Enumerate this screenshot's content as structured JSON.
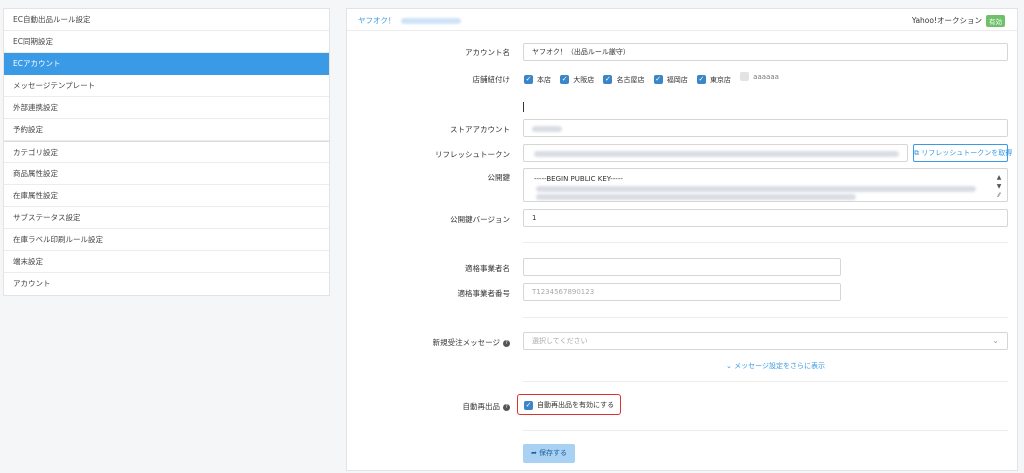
{
  "sidebar": {
    "items": [
      {
        "label": "EC自動出品ルール設定"
      },
      {
        "label": "EC同期設定"
      },
      {
        "label": "ECアカウント"
      },
      {
        "label": "メッセージテンプレート"
      },
      {
        "label": "外部連携設定"
      },
      {
        "label": "予約設定"
      },
      {
        "label": "カテゴリ設定"
      },
      {
        "label": "商品属性設定"
      },
      {
        "label": "在庫属性設定"
      },
      {
        "label": "サブステータス設定"
      },
      {
        "label": "在庫ラベル印刷ルール設定"
      },
      {
        "label": "端末設定"
      },
      {
        "label": "アカウント"
      }
    ]
  },
  "header": {
    "title": "ヤフオク！",
    "service": "Yahoo!オークション",
    "status_badge": "有効"
  },
  "form": {
    "account_name_label": "アカウント名",
    "account_name_value": "ヤフオク！（出品ルール厳守）",
    "stores_label": "店舗紐付け",
    "stores": [
      {
        "label": "本店",
        "checked": true
      },
      {
        "label": "大阪店",
        "checked": true
      },
      {
        "label": "名古屋店",
        "checked": true
      },
      {
        "label": "福岡店",
        "checked": true
      },
      {
        "label": "東京店",
        "checked": true
      },
      {
        "label": "aaaaaa",
        "checked": false
      }
    ],
    "store_account_label": "ストアアカウント",
    "refresh_token_label": "リフレッシュトークン",
    "refresh_button": "リフレッシュトークンを取得",
    "public_key_label": "公開鍵",
    "public_key_value": "-----BEGIN PUBLIC KEY-----",
    "public_key_version_label": "公開鍵バージョン",
    "public_key_version_value": "1",
    "business_name_label": "適格事業者名",
    "business_name_value": "",
    "business_number_label": "適格事業者番号",
    "business_number_placeholder": "T1234567890123",
    "new_order_message_label": "新規受注メッセージ",
    "new_order_message_placeholder": "選択してください",
    "more_messages_link": "⌄ メッセージ設定をさらに表示",
    "auto_relist_label": "自動再出品",
    "auto_relist_checkbox": "自動再出品を有効にする",
    "save_button": "保存する"
  },
  "colors": {
    "accent": "#3a9ae6",
    "badge": "#6ec06a",
    "highlight": "#e03131"
  }
}
